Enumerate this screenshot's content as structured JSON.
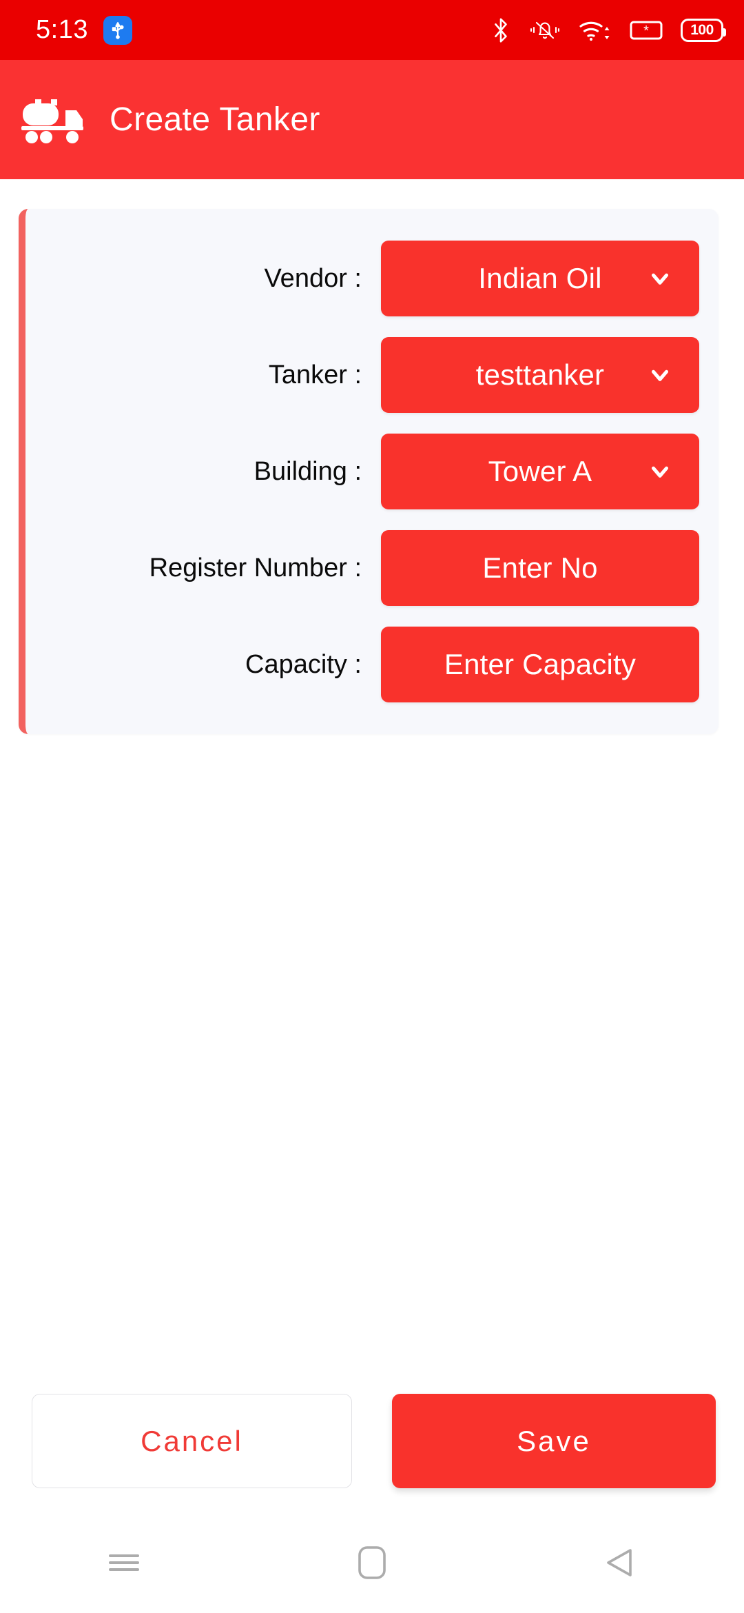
{
  "status_bar": {
    "clock": "5:13",
    "usb_icon": "usb-icon",
    "icons": [
      "bluetooth-icon",
      "vibrate-mute-icon",
      "wifi-icon",
      "sim-signal-icon",
      "battery-icon"
    ],
    "battery_level": "100",
    "background_color": "#EA0000"
  },
  "app_bar": {
    "icon": "tanker-truck-icon",
    "title": "Create Tanker",
    "background_color": "#FA3232"
  },
  "form": {
    "accent_color": "#F9322C",
    "stripe_color": "#F2625F",
    "card_background": "#F7F8FC",
    "rows": [
      {
        "label": "Vendor :",
        "value": "Indian Oil",
        "type": "dropdown",
        "icon": "chevron-down-icon",
        "name": "vendor"
      },
      {
        "label": "Tanker :",
        "value": "testtanker",
        "type": "dropdown",
        "icon": "chevron-down-icon",
        "name": "tanker"
      },
      {
        "label": "Building :",
        "value": "Tower A",
        "type": "dropdown",
        "icon": "chevron-down-icon",
        "name": "building"
      },
      {
        "label": "Register Number :",
        "value": "Enter No",
        "type": "input",
        "icon": "",
        "name": "register-number"
      },
      {
        "label": "Capacity :",
        "value": "Enter Capacity",
        "type": "input",
        "icon": "",
        "name": "capacity"
      }
    ]
  },
  "actions": {
    "cancel_label": "Cancel",
    "save_label": "Save",
    "cancel_text_color": "#F03A36",
    "save_background": "#F9322C"
  },
  "nav_bar": {
    "recents_label": "recents-icon",
    "home_label": "home-icon",
    "back_label": "back-icon"
  }
}
